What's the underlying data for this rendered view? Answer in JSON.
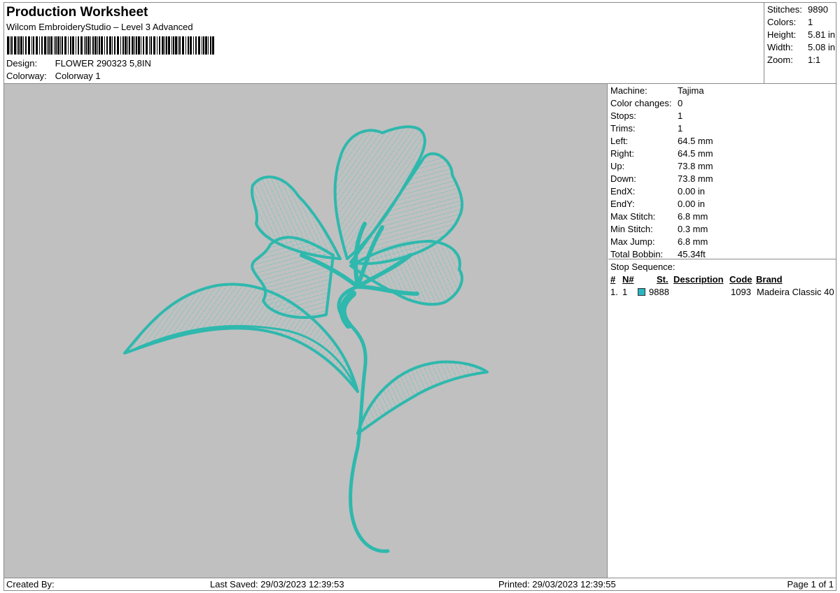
{
  "header": {
    "title": "Production Worksheet",
    "software": "Wilcom EmbroideryStudio – Level 3 Advanced",
    "design_label": "Design:",
    "design_value": "FLOWER 290323 5,8IN",
    "colorway_label": "Colorway:",
    "colorway_value": "Colorway 1"
  },
  "stats": [
    {
      "label": "Stitches:",
      "value": "9890"
    },
    {
      "label": "Colors:",
      "value": "1"
    },
    {
      "label": "Height:",
      "value": "5.81 in"
    },
    {
      "label": "Width:",
      "value": "5.08 in"
    },
    {
      "label": "Zoom:",
      "value": "1:1"
    }
  ],
  "machine_info": [
    {
      "label": "Machine:",
      "value": "Tajima"
    },
    {
      "label": "Color changes:",
      "value": "0"
    },
    {
      "label": "Stops:",
      "value": "1"
    },
    {
      "label": "Trims:",
      "value": "1"
    },
    {
      "label": "Left:",
      "value": "64.5 mm"
    },
    {
      "label": "Right:",
      "value": "64.5 mm"
    },
    {
      "label": "Up:",
      "value": "73.8 mm"
    },
    {
      "label": "Down:",
      "value": "73.8 mm"
    },
    {
      "label": "EndX:",
      "value": "0.00 in"
    },
    {
      "label": "EndY:",
      "value": "0.00 in"
    },
    {
      "label": "Max Stitch:",
      "value": "6.8 mm"
    },
    {
      "label": "Min Stitch:",
      "value": "0.3 mm"
    },
    {
      "label": "Max Jump:",
      "value": "6.8 mm"
    },
    {
      "label": "Total Bobbin:",
      "value": "45.34ft"
    }
  ],
  "stop_sequence": {
    "title": "Stop Sequence:",
    "columns": {
      "num": "#",
      "n": "N#",
      "st": "St.",
      "description": "Description",
      "code": "Code",
      "brand": "Brand"
    },
    "rows": [
      {
        "num": "1.",
        "n": "1",
        "color": "#2ab5c2",
        "st": "9888",
        "description": "",
        "code": "1093",
        "brand": "Madeira Classic 40"
      }
    ]
  },
  "footer": {
    "created_by": "Created By:",
    "last_saved": "Last Saved: 29/03/2023 12:39:53",
    "printed": "Printed: 29/03/2023 12:39:55",
    "page": "Page 1 of 1"
  },
  "colors": {
    "thread": "#3cc8be",
    "thread_dark": "#2a9e96",
    "preview_bg": "#c0c0c0"
  }
}
